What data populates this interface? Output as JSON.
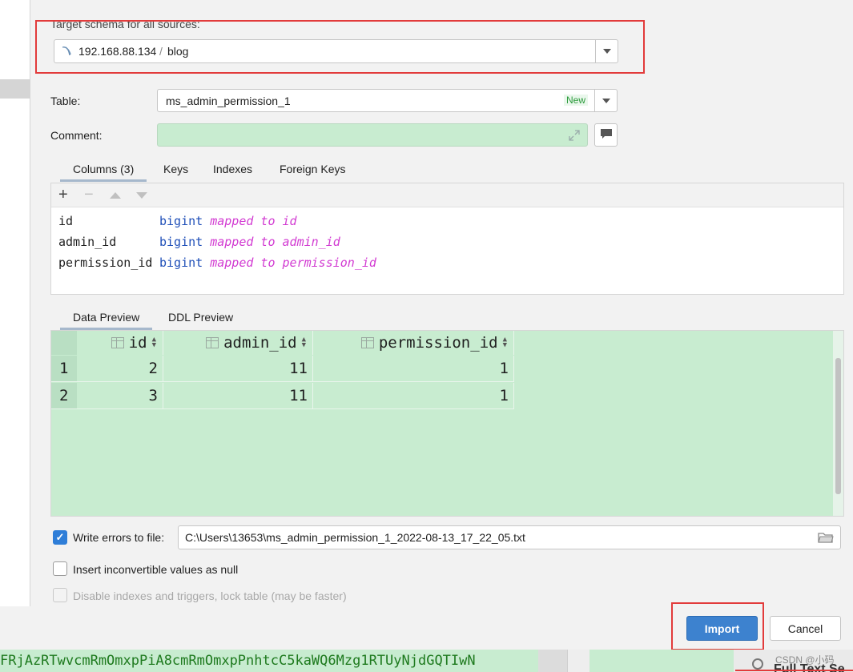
{
  "dialog": {
    "target_schema_label": "Target schema for all sources:",
    "schema_host": "192.168.88.134",
    "schema_sep": "/",
    "schema_name": "blog",
    "table_label": "Table:",
    "table_value": "ms_admin_permission_1",
    "table_badge": "New",
    "comment_label": "Comment:",
    "comment_value": ""
  },
  "column_tabs": [
    {
      "label": "Columns (3)",
      "active": true
    },
    {
      "label": "Keys",
      "active": false
    },
    {
      "label": "Indexes",
      "active": false
    },
    {
      "label": "Foreign Keys",
      "active": false
    }
  ],
  "toolbar": {
    "add": "+",
    "remove": "−"
  },
  "columns": [
    {
      "name": "id",
      "type": "bigint",
      "mapped_text": "mapped to",
      "target": "id"
    },
    {
      "name": "admin_id",
      "type": "bigint",
      "mapped_text": "mapped to",
      "target": "admin_id"
    },
    {
      "name": "permission_id",
      "type": "bigint",
      "mapped_text": "mapped to",
      "target": "permission_id"
    }
  ],
  "preview_tabs": [
    {
      "label": "Data Preview",
      "active": true
    },
    {
      "label": "DDL Preview",
      "active": false
    }
  ],
  "preview": {
    "headers": [
      "id",
      "admin_id",
      "permission_id"
    ],
    "rows": [
      {
        "num": "1",
        "cells": [
          "2",
          "11",
          "1"
        ]
      },
      {
        "num": "2",
        "cells": [
          "3",
          "11",
          "1"
        ]
      }
    ]
  },
  "options": {
    "write_errors_label": "Write errors to file:",
    "write_errors_checked": true,
    "error_file_path": "C:\\Users\\13653\\ms_admin_permission_1_2022-08-13_17_22_05.txt",
    "insert_null_label": "Insert inconvertible values as null",
    "insert_null_checked": false,
    "disable_indexes_label": "Disable indexes and triggers, lock table (may be faster)",
    "disable_indexes_checked": false
  },
  "buttons": {
    "import": "Import",
    "cancel": "Cancel"
  },
  "background": {
    "terminal_text": "FRjAzRTwvcmRmOmxpPiA8cmRmOmxpPnhtcC5kaWQ6Mzg1RTUyNjdGQTIwN",
    "watermark": "CSDN @小码",
    "bottom_right_text": "Full Text Se"
  },
  "colors": {
    "highlight_red": "#e23b3b",
    "preview_green": "#c8ecd0",
    "accent_blue": "#3d82cf"
  }
}
